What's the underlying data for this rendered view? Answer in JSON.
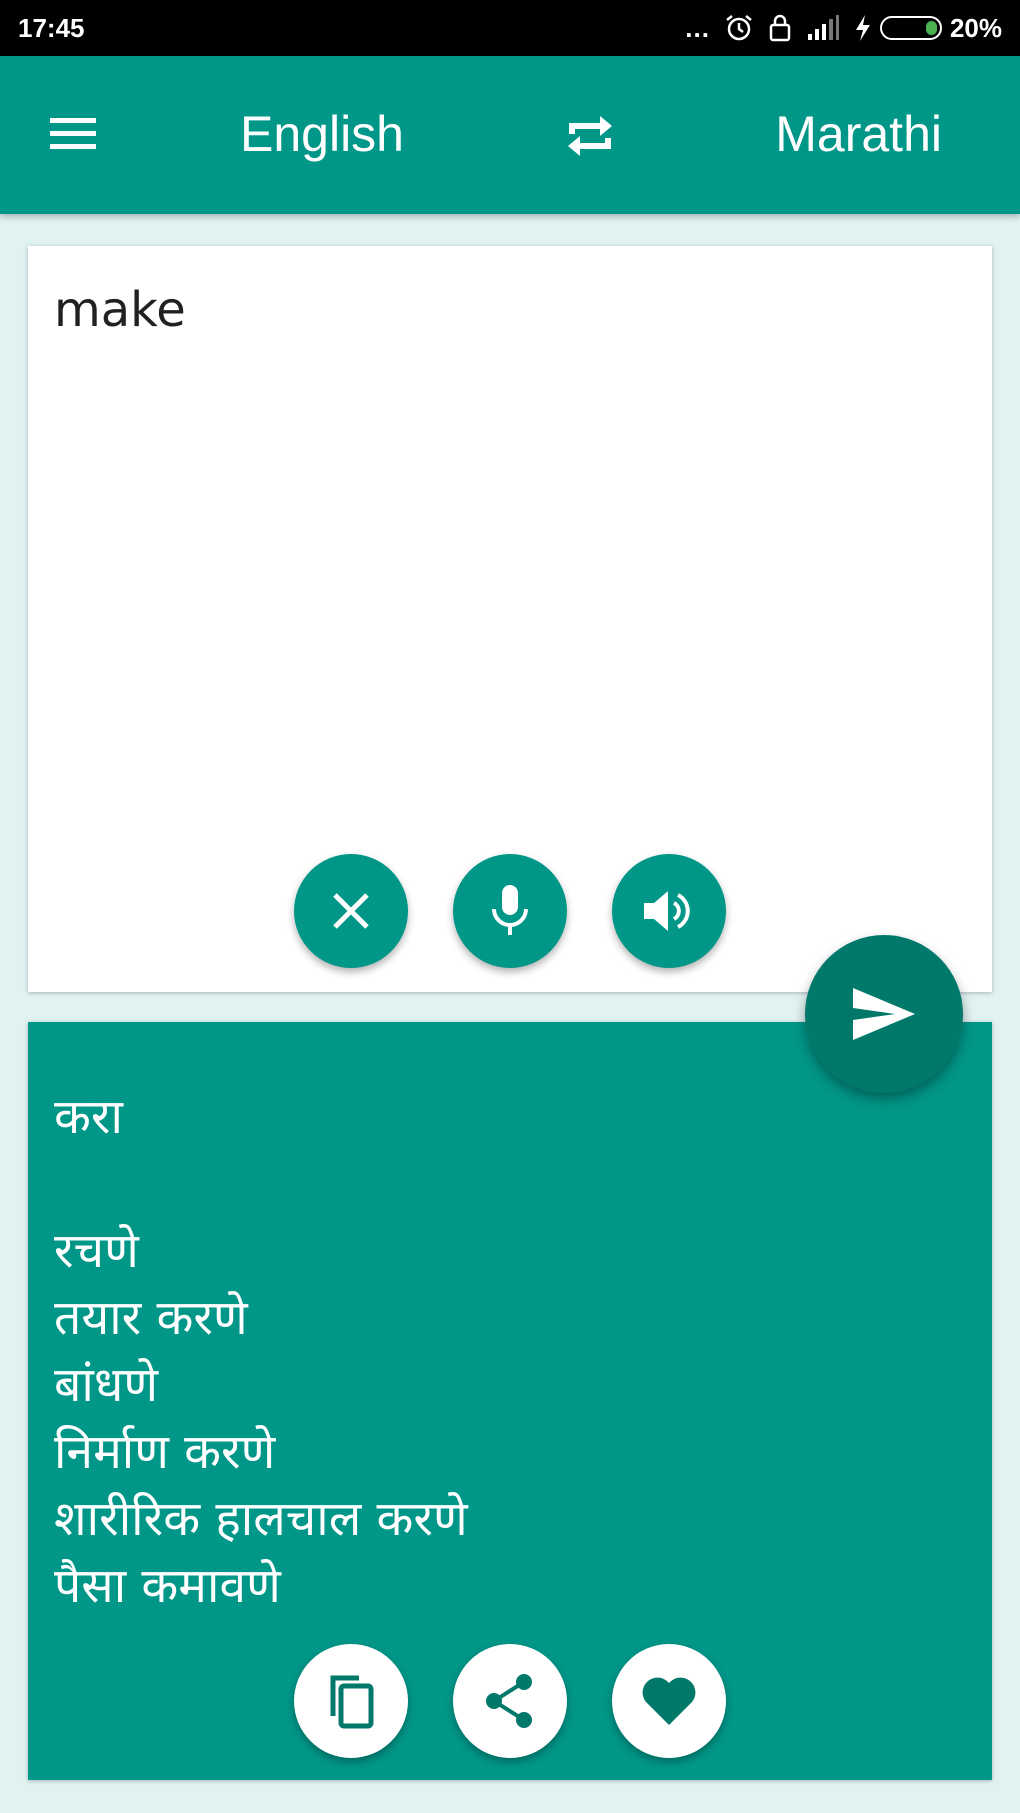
{
  "status_bar": {
    "time": "17:45",
    "dots": "...",
    "battery_percent": "20%",
    "battery_level": 0.2
  },
  "toolbar": {
    "source_language": "English",
    "target_language": "Marathi"
  },
  "input": {
    "text": "make"
  },
  "output": {
    "primary": "करा",
    "alternatives": [
      "रचणे",
      "तयार करणे",
      "बांधणे",
      "निर्माण करणे",
      "शारीरिक हालचाल करणे",
      "पैसा कमावणे"
    ]
  },
  "colors": {
    "primary": "#009688",
    "primary_dark": "#00796b",
    "background": "#e0f2f1"
  },
  "icons": {
    "menu": "menu-icon",
    "swap": "swap-languages-icon",
    "clear": "close-icon",
    "mic": "microphone-icon",
    "speaker": "speaker-icon",
    "send": "send-icon",
    "copy": "copy-icon",
    "share": "share-icon",
    "favorite": "heart-icon"
  }
}
